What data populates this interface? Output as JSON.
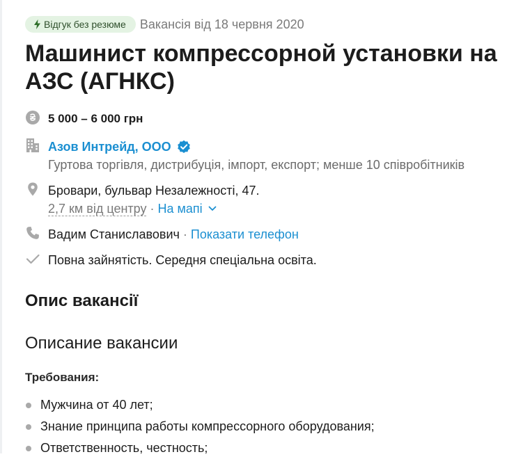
{
  "header": {
    "badge_label": "Відгук без резюме",
    "posted": "Вакансія від 18 червня 2020",
    "title": "Машинист компрессорной установки на АЗС (АГНКС)"
  },
  "salary": {
    "text": "5 000 – 6 000 грн"
  },
  "company": {
    "name": "Азов Интрейд, ООО",
    "description": "Гуртова торгівля, дистрибуція, імпорт, експорт; менше 10 співробітників"
  },
  "location": {
    "address": "Бровари, бульвар Незалежності, 47.",
    "distance": "2,7 км від центру",
    "separator": " · ",
    "map_link": "На мапі"
  },
  "contact": {
    "name": "Вадим Станиславович",
    "separator": " · ",
    "phone_link": "Показати телефон"
  },
  "conditions": {
    "text": "Повна зайнятість. Середня спеціальна освіта."
  },
  "description": {
    "section_title": "Опис вакансії",
    "subtitle": "Описание вакансии",
    "requirements_label": "Требования:",
    "requirements": [
      "Мужчина от 40 лет;",
      "Знание принципа работы компрессорного оборудования;",
      "Ответственность, честность;"
    ]
  },
  "icons": {
    "badge": "lightning-icon",
    "salary": "hryvnia-coin-icon",
    "company": "building-icon",
    "verified": "verified-check-icon",
    "location": "map-pin-icon",
    "map_toggle": "chevron-down-icon",
    "contact": "phone-icon",
    "conditions": "checkmark-icon"
  },
  "colors": {
    "link": "#1b8fd1",
    "badge_bg": "#e4f3e3",
    "muted_text": "#6b6b6b",
    "icon_gray": "#a9a9a9"
  }
}
